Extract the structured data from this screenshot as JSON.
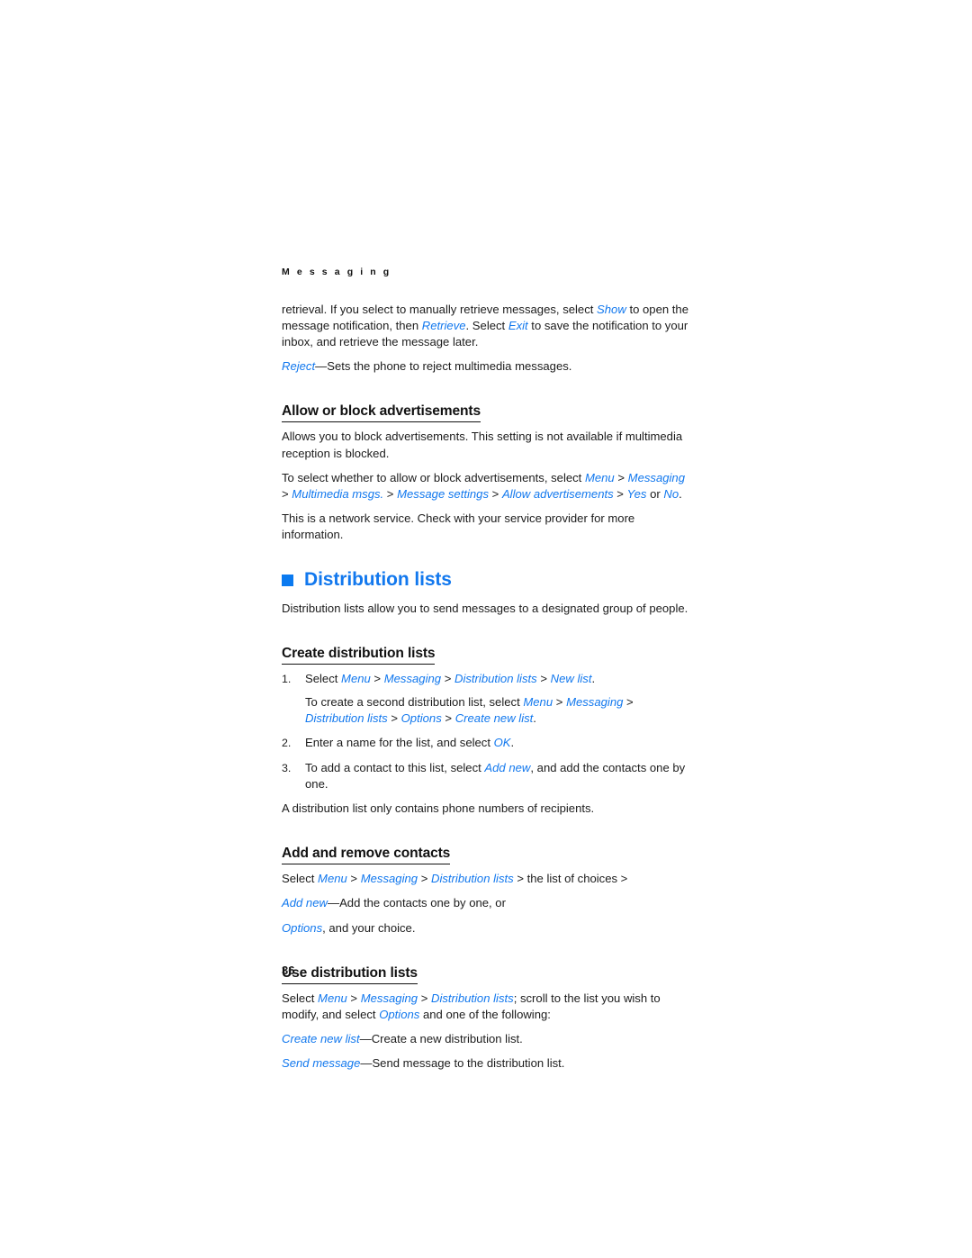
{
  "document": {
    "running_header": "M e s s a g i n g",
    "page_number": "36",
    "accent_color": "#1278EE",
    "bullet_color": "#0B7AF0",
    "text_color": "#1c1c1c"
  },
  "intro": {
    "paragraph_1": {
      "part_1": "retrieval. If you select to manually retrieve messages, select ",
      "ui_1": "Show",
      "part_2": " to open the message notification, then ",
      "ui_2": "Retrieve",
      "part_3": ". Select ",
      "ui_3": "Exit",
      "part_4": " to save the notification to your inbox, and retrieve the message later."
    },
    "paragraph_2": {
      "ui_1": "Reject",
      "part_1": "—Sets the phone to reject multimedia messages."
    }
  },
  "allow_block": {
    "heading": "Allow or block advertisements",
    "paragraph_1": "Allows you to block advertisements. This setting is not available if multimedia reception is blocked.",
    "paragraph_2": {
      "part_1": "To select whether to allow or block advertisements, select ",
      "ui_1": "Menu",
      "sep_1": " > ",
      "ui_2": "Messaging",
      "sep_2": " > ",
      "ui_3": "Multimedia msgs.",
      "sep_3": " > ",
      "ui_4": "Message settings",
      "sep_4": " > ",
      "ui_5": "Allow advertisements",
      "sep_5": " > ",
      "ui_6": "Yes",
      "part_2": " or ",
      "ui_7": "No",
      "part_3": "."
    },
    "paragraph_3": "This is a network service. Check with your service provider for more information."
  },
  "distribution_lists": {
    "heading": "Distribution lists",
    "intro_paragraph": "Distribution lists allow you to send messages to a designated group of people.",
    "create": {
      "heading": "Create distribution lists",
      "step_1": {
        "number": "1.",
        "part_1": "Select ",
        "ui_1": "Menu",
        "sep_1": " > ",
        "ui_2": "Messaging",
        "sep_2": " > ",
        "ui_3": "Distribution lists",
        "sep_3": " > ",
        "ui_4": "New list",
        "part_2": ".",
        "extra": {
          "part_1": "To create a second distribution list, select ",
          "ui_1": "Menu",
          "sep_1": " > ",
          "ui_2": "Messaging",
          "sep_2": " > ",
          "ui_3": "Distribution lists",
          "sep_3": " > ",
          "ui_4": "Options",
          "sep_4": " > ",
          "ui_5": "Create new list",
          "part_2": "."
        }
      },
      "step_2": {
        "number": "2.",
        "part_1": "Enter a name for the list, and select ",
        "ui_1": "OK",
        "part_2": "."
      },
      "step_3": {
        "number": "3.",
        "part_1": "To add a contact to this list, select ",
        "ui_1": "Add new",
        "part_2": ", and add the contacts one by one."
      },
      "note": "A distribution list only contains phone numbers of recipients."
    },
    "add_remove": {
      "heading": "Add and remove contacts",
      "line_1": {
        "part_1": "Select ",
        "ui_1": "Menu",
        "sep_1": " > ",
        "ui_2": "Messaging",
        "sep_2": " > ",
        "ui_3": "Distribution lists",
        "part_2": " > the list of choices >"
      },
      "line_2": {
        "ui_1": "Add new",
        "part_1": "—Add the contacts one by one, or"
      },
      "line_3": {
        "ui_1": "Options",
        "part_1": ", and your choice."
      }
    },
    "use": {
      "heading": "Use distribution lists",
      "line_1": {
        "part_1": "Select ",
        "ui_1": "Menu",
        "sep_1": " > ",
        "ui_2": "Messaging",
        "sep_2": " > ",
        "ui_3": "Distribution lists",
        "part_2": "; scroll to the list you wish to modify, and select ",
        "ui_4": "Options",
        "part_3": " and one of the following:"
      },
      "option_1": {
        "ui_1": "Create new list",
        "part_1": "—Create a new distribution list."
      },
      "option_2": {
        "ui_1": "Send message",
        "part_1": "—Send message to the distribution list."
      }
    }
  }
}
